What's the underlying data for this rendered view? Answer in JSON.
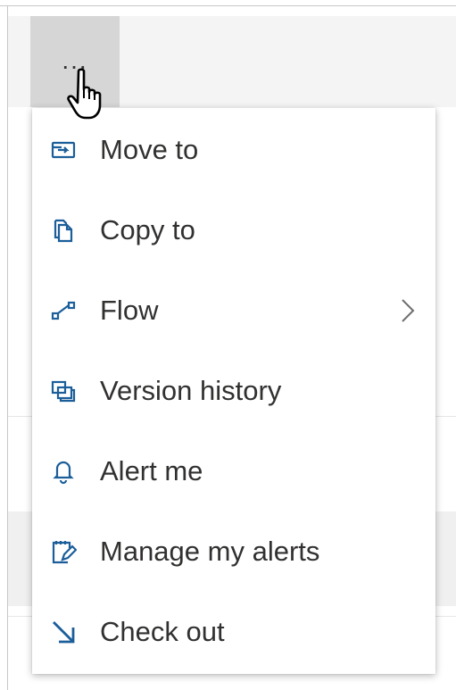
{
  "more_button": {
    "label": "...",
    "icon": "more-icon"
  },
  "cursor": {
    "icon": "hand-pointer-icon"
  },
  "menu": {
    "items": [
      {
        "label": "Move to",
        "icon": "move-to-icon"
      },
      {
        "label": "Copy to",
        "icon": "copy-icon"
      },
      {
        "label": "Flow",
        "icon": "flow-icon",
        "submenu_icon": "chevron-right-icon"
      },
      {
        "label": "Version history",
        "icon": "version-history-icon"
      },
      {
        "label": "Alert me",
        "icon": "bell-icon"
      },
      {
        "label": "Manage my alerts",
        "icon": "manage-alerts-icon"
      },
      {
        "label": "Check out",
        "icon": "check-out-icon"
      }
    ]
  },
  "colors": {
    "icon_accent": "#1b5e9a",
    "text": "#323130",
    "hover_background": "#d6d6d6"
  }
}
